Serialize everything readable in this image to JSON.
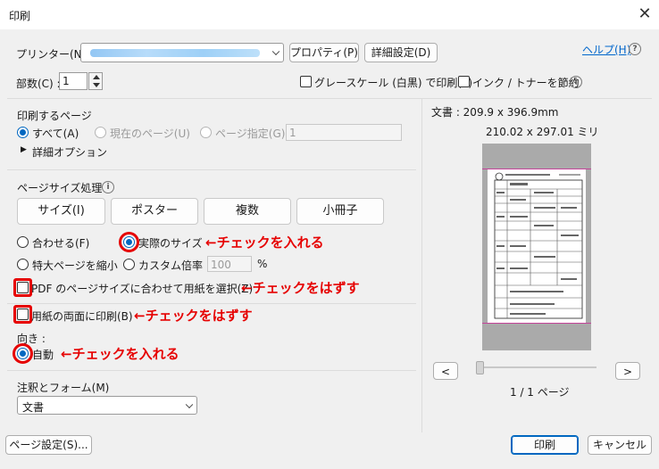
{
  "window": {
    "title": "印刷",
    "close_glyph": "✕"
  },
  "printer": {
    "label": "プリンター(N) :",
    "selected": "",
    "properties_button": "プロパティ(P)",
    "advanced_button": "詳細設定(D)",
    "help_link": "ヘルプ(H)"
  },
  "copies": {
    "label": "部数(C) :",
    "value": "1"
  },
  "options": {
    "grayscale": "グレースケール (白黒) で印刷(Y)",
    "save_ink": "インク / トナーを節約"
  },
  "pages_to_print": {
    "heading": "印刷するページ",
    "all": "すべて(A)",
    "current": "現在のページ(U)",
    "pages": "ページ指定(G)",
    "pages_value": "1",
    "more_options": "詳細オプション"
  },
  "page_sizing": {
    "heading": "ページサイズ処理",
    "buttons": [
      "サイズ(I)",
      "ポスター",
      "複数",
      "小冊子"
    ],
    "fit": "合わせる(F)",
    "actual_size": "実際のサイズ",
    "shrink": "特大ページを縮小",
    "custom_scale": "カスタム倍率 :",
    "custom_value": "100",
    "percent": "%",
    "choose_paper": "PDF のページサイズに合わせて用紙を選択(Z)"
  },
  "duplex": {
    "label": "用紙の両面に印刷(B)"
  },
  "orientation": {
    "heading": "向き :",
    "auto": "自動"
  },
  "comments": {
    "heading": "注釈とフォーム(M)",
    "selected": "文書"
  },
  "annotations": {
    "check_on_1": "←チェックを入れる",
    "check_off_1": "←チェックをはずす",
    "check_off_2": "←チェックをはずす",
    "check_on_2": "←チェックを入れる"
  },
  "preview": {
    "doc_size": "文書 : 209.9 x 396.9mm",
    "paper_size": "210.02 x 297.01 ミリ",
    "page_indicator": "1 / 1 ページ",
    "prev": "<",
    "next": ">"
  },
  "footer": {
    "page_setup": "ページ設定(S)...",
    "print": "印刷",
    "cancel": "キャンセル"
  },
  "colors": {
    "accent": "#0067c0",
    "annotation": "#e60000",
    "link": "#0066cc"
  }
}
